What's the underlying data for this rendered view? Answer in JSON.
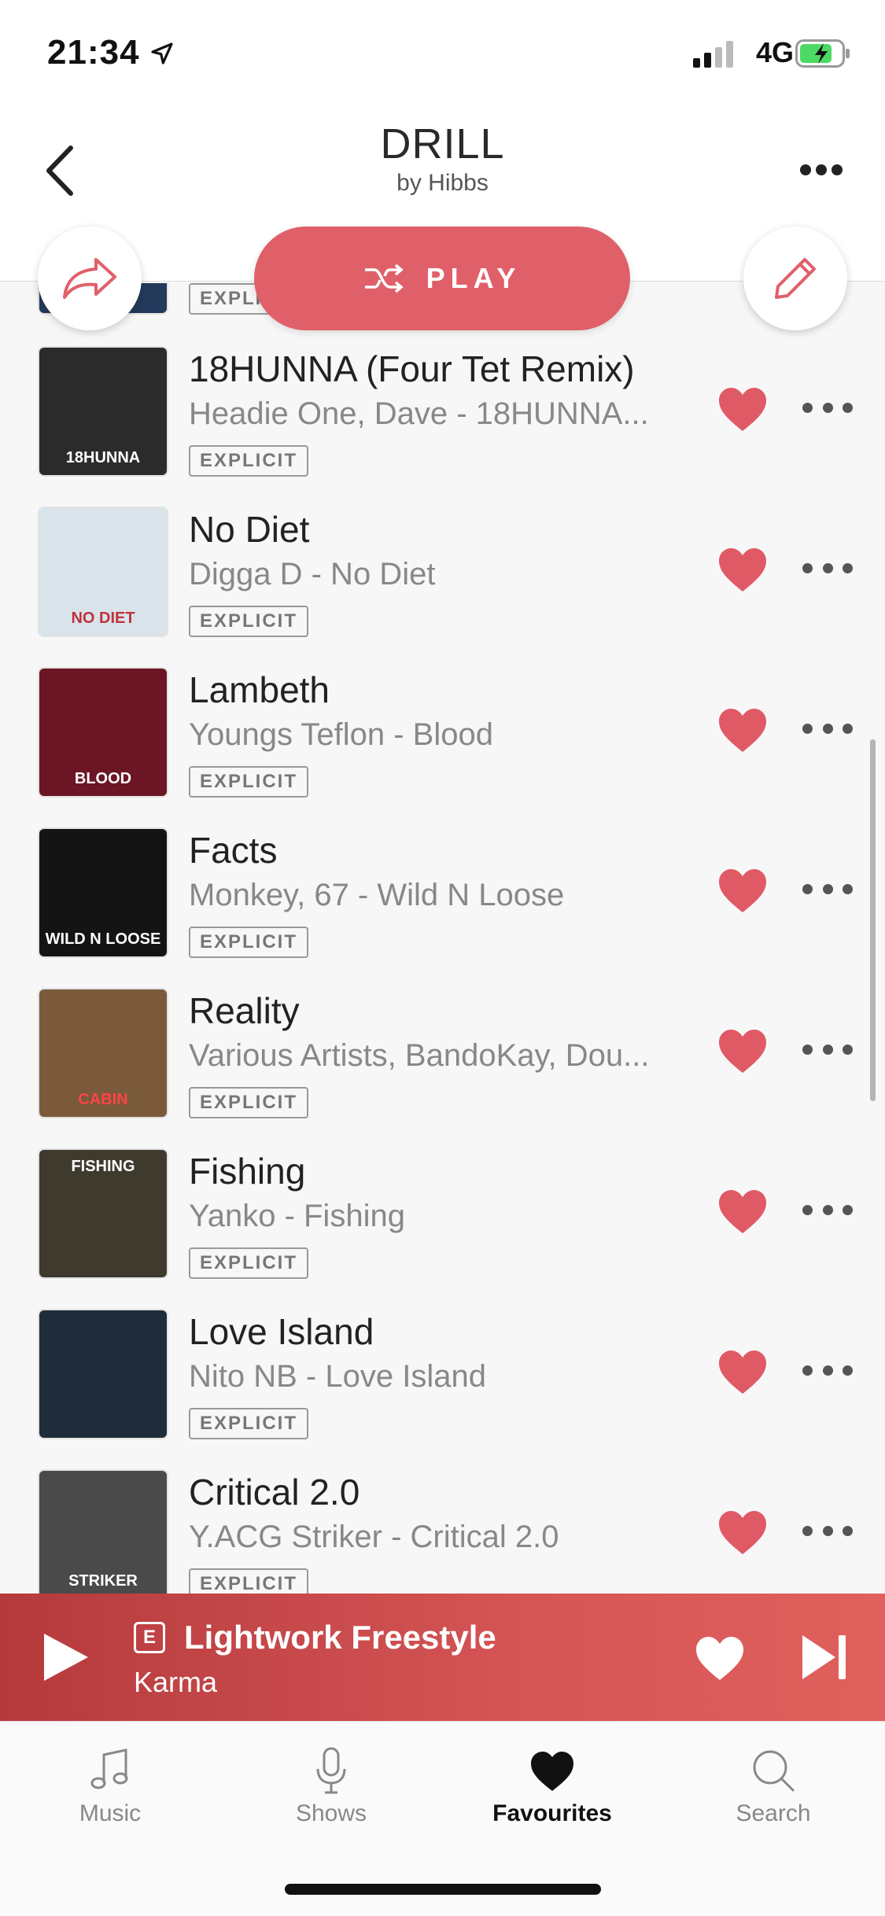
{
  "status_bar": {
    "time": "21:34",
    "network": "4G"
  },
  "header": {
    "title": "DRILL",
    "subtitle": "by Hibbs"
  },
  "actions": {
    "play_label": "PLAY"
  },
  "partial_track": {
    "explicit": "EXPLICIT"
  },
  "tracks": [
    {
      "title": "18HUNNA (Four Tet Remix)",
      "subtitle": "Headie One, Dave - 18HUNNA...",
      "explicit": "EXPLICIT",
      "art_text": "18HUNNA",
      "art_color": "#2b2b2b"
    },
    {
      "title": "No Diet",
      "subtitle": "Digga D - No Diet",
      "explicit": "EXPLICIT",
      "art_text": "NO DIET",
      "art_color": "#d9e3ea"
    },
    {
      "title": "Lambeth",
      "subtitle": "Youngs Teflon - Blood",
      "explicit": "EXPLICIT",
      "art_text": "BLOOD",
      "art_color": "#6b1525"
    },
    {
      "title": "Facts",
      "subtitle": "Monkey, 67 - Wild N Loose",
      "explicit": "EXPLICIT",
      "art_text": "WILD N LOOSE",
      "art_color": "#141414"
    },
    {
      "title": "Reality",
      "subtitle": "Various Artists, BandoKay, Dou...",
      "explicit": "EXPLICIT",
      "art_text": "CABIN",
      "art_color": "#7a5a3a"
    },
    {
      "title": "Fishing",
      "subtitle": "Yanko - Fishing",
      "explicit": "EXPLICIT",
      "art_text": "FISHING",
      "art_color": "#3f3a2e"
    },
    {
      "title": "Love Island",
      "subtitle": "Nito NB - Love Island",
      "explicit": "EXPLICIT",
      "art_text": "",
      "art_color": "#1f2d3a"
    },
    {
      "title": "Critical 2.0",
      "subtitle": "Y.ACG Striker - Critical 2.0",
      "explicit": "EXPLICIT",
      "art_text": "STRIKER",
      "art_color": "#4a4a4a"
    }
  ],
  "now_playing": {
    "explicit_badge": "E",
    "title": "Lightwork Freestyle",
    "artist": "Karma"
  },
  "tabs": [
    {
      "label": "Music",
      "icon": "music-note-icon"
    },
    {
      "label": "Shows",
      "icon": "microphone-icon"
    },
    {
      "label": "Favourites",
      "icon": "heart-icon",
      "active": true
    },
    {
      "label": "Search",
      "icon": "search-icon"
    }
  ],
  "colors": {
    "accent": "#e06069",
    "heart": "#e05a66",
    "player_bg": "#c8484a"
  }
}
